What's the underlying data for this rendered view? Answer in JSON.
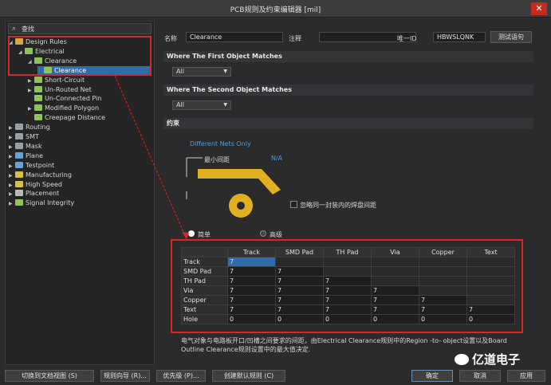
{
  "window": {
    "title": "PCB规则及约束编辑器 [mil]",
    "close": "✕"
  },
  "search": {
    "placeholder": "查找"
  },
  "tree": [
    {
      "label": "Design Rules",
      "level": 0,
      "arrow": "◢",
      "color": "#d6a93a"
    },
    {
      "label": "Electrical",
      "level": 1,
      "arrow": "◢",
      "color": "#8fc25a"
    },
    {
      "label": "Clearance",
      "level": 2,
      "arrow": "◢",
      "color": "#8fc25a"
    },
    {
      "label": "Clearance",
      "level": 3,
      "arrow": "",
      "color": "#8fc25a",
      "selected": true
    },
    {
      "label": "Short-Circuit",
      "level": 2,
      "arrow": "▶",
      "color": "#8fc25a"
    },
    {
      "label": "Un-Routed Net",
      "level": 2,
      "arrow": "▶",
      "color": "#8fc25a"
    },
    {
      "label": "Un-Connected Pin",
      "level": 2,
      "arrow": "",
      "color": "#8fc25a"
    },
    {
      "label": "Modified Polygon",
      "level": 2,
      "arrow": "▶",
      "color": "#8fc25a"
    },
    {
      "label": "Creepage Distance",
      "level": 2,
      "arrow": "",
      "color": "#8fc25a"
    },
    {
      "label": "Routing",
      "level": 0,
      "arrow": "▶",
      "color": "#9aa0a6"
    },
    {
      "label": "SMT",
      "level": 0,
      "arrow": "▶",
      "color": "#9aa0a6"
    },
    {
      "label": "Mask",
      "level": 0,
      "arrow": "▶",
      "color": "#9aa0a6"
    },
    {
      "label": "Plane",
      "level": 0,
      "arrow": "▶",
      "color": "#6aa0d8"
    },
    {
      "label": "Testpoint",
      "level": 0,
      "arrow": "▶",
      "color": "#6aa0d8"
    },
    {
      "label": "Manufacturing",
      "level": 0,
      "arrow": "▶",
      "color": "#d8c040"
    },
    {
      "label": "High Speed",
      "level": 0,
      "arrow": "▶",
      "color": "#d8c040"
    },
    {
      "label": "Placement",
      "level": 0,
      "arrow": "▶",
      "color": "#bbbbbb"
    },
    {
      "label": "Signal Integrity",
      "level": 0,
      "arrow": "▶",
      "color": "#8fc25a"
    }
  ],
  "form": {
    "name_label": "名称",
    "name_value": "Clearance",
    "comment_label": "注释",
    "comment_value": "",
    "id_label": "唯一ID",
    "id_value": "HBWSLQNK",
    "test_button": "测试语句"
  },
  "first_match": {
    "title": "Where The First Object Matches",
    "value": "All"
  },
  "second_match": {
    "title": "Where The Second Object Matches",
    "value": "All"
  },
  "constraints": {
    "title": "约束",
    "nets_link": "Different Nets Only",
    "min_clearance_label": "最小间距",
    "min_clearance_value": "N/A",
    "ignore_pad_label": "忽略同一封装内的焊盘间距",
    "simple_label": "简单",
    "advanced_label": "高级"
  },
  "matrix": {
    "columns": [
      "Track",
      "SMD Pad",
      "TH Pad",
      "Via",
      "Copper",
      "Text"
    ],
    "rows": [
      {
        "name": "Track",
        "values": [
          "7",
          "",
          "",
          "",
          "",
          ""
        ]
      },
      {
        "name": "SMD Pad",
        "values": [
          "7",
          "7",
          "",
          "",
          "",
          ""
        ]
      },
      {
        "name": "TH Pad",
        "values": [
          "7",
          "7",
          "7",
          "",
          "",
          ""
        ]
      },
      {
        "name": "Via",
        "values": [
          "7",
          "7",
          "7",
          "7",
          "",
          ""
        ]
      },
      {
        "name": "Copper",
        "values": [
          "7",
          "7",
          "7",
          "7",
          "7",
          ""
        ]
      },
      {
        "name": "Text",
        "values": [
          "7",
          "7",
          "7",
          "7",
          "7",
          "7"
        ]
      },
      {
        "name": "Hole",
        "values": [
          "0",
          "0",
          "0",
          "0",
          "0",
          "0"
        ]
      }
    ]
  },
  "note": "电气对象与电路板开口/凹槽之间要求的间距，由Electrical Clearance规则中的Region -to- object设置以及Board Outline Clearance规则设置中的最大值决定.",
  "buttons": {
    "switch_doc": "切换到文档视图 (S)",
    "wizard": "规则向导 (R)...",
    "priority": "优先级 (P)...",
    "create_default": "创建默认规则 (C)",
    "ok": "确定",
    "cancel": "取消",
    "apply": "应用"
  },
  "watermark": "亿道电子"
}
